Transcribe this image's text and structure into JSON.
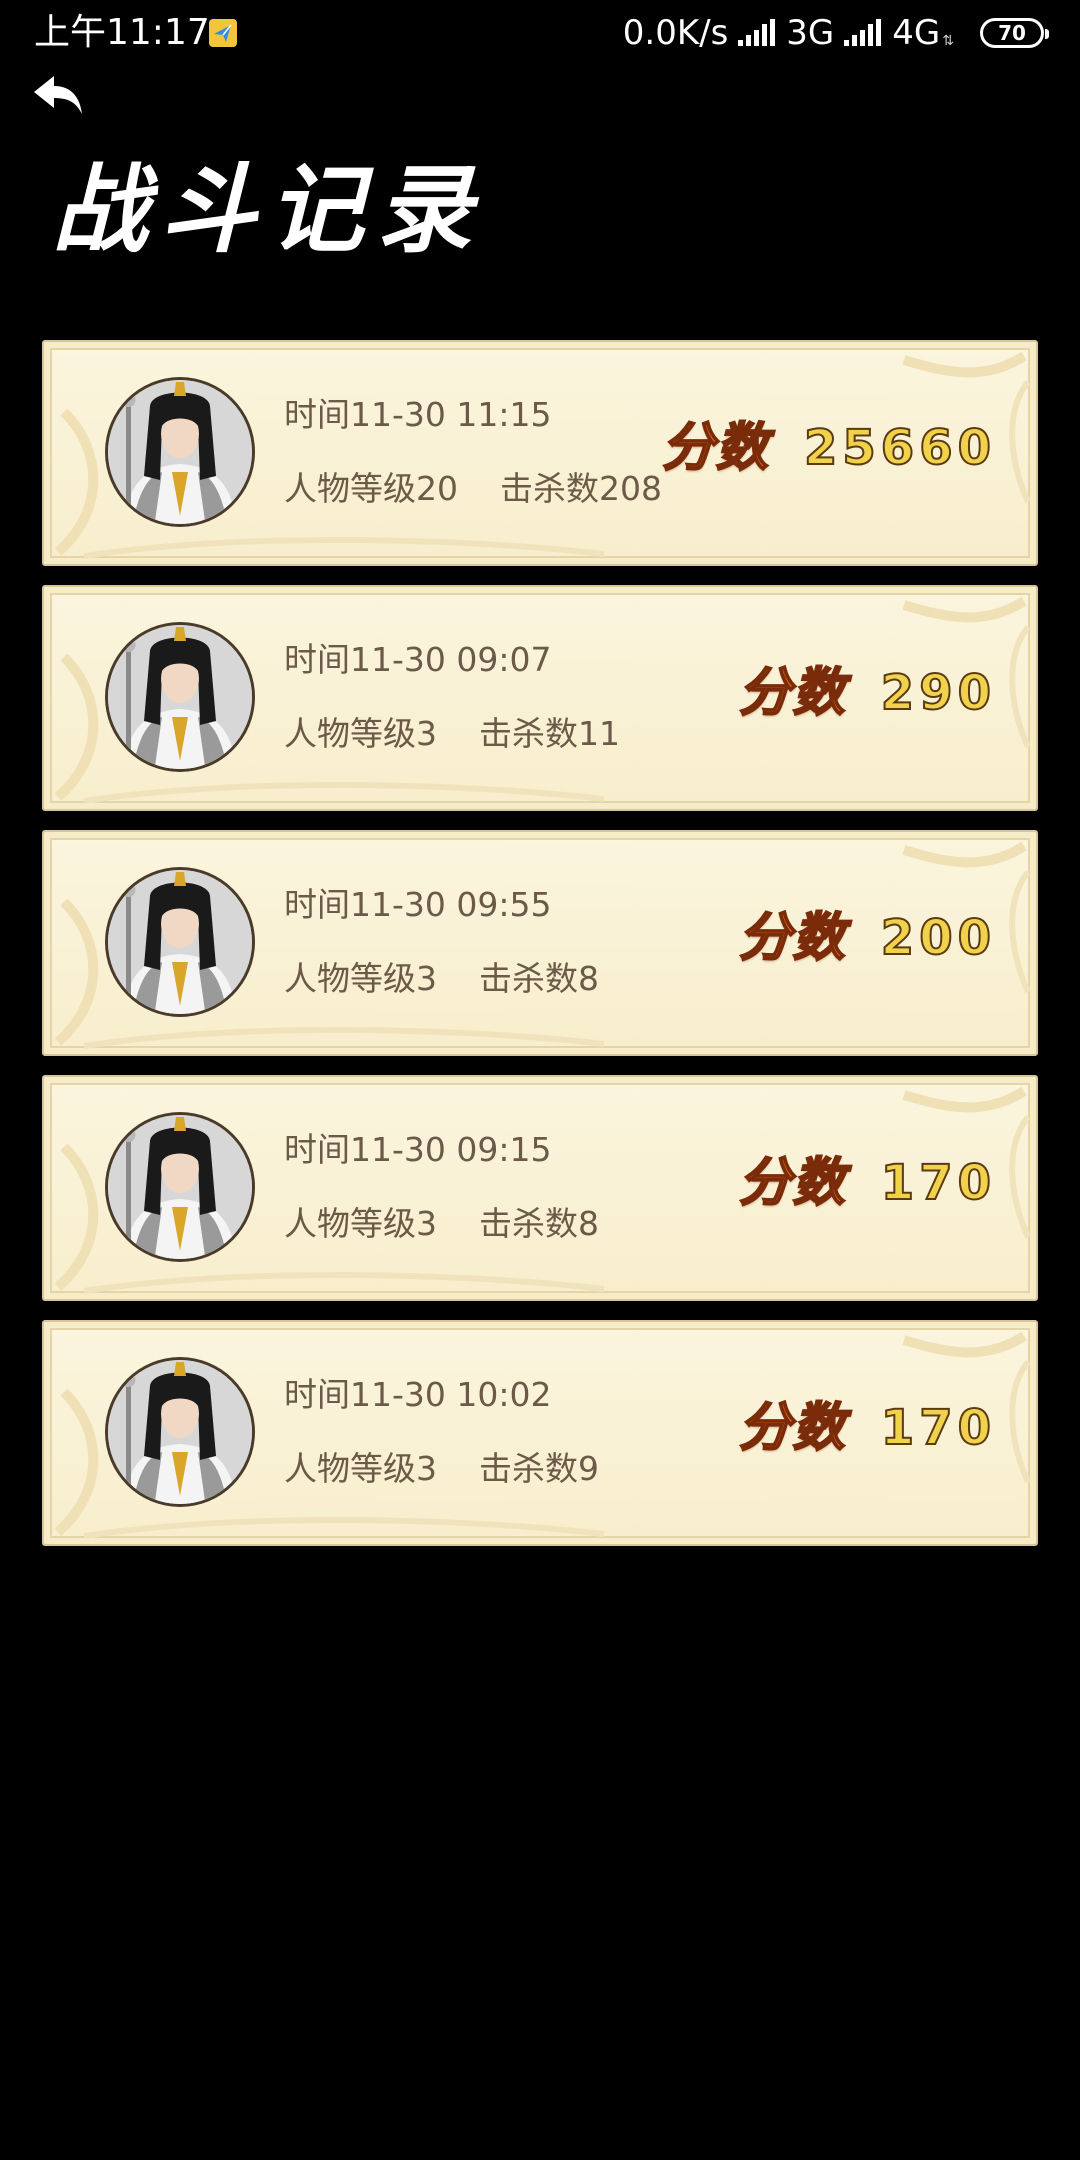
{
  "status_bar": {
    "time": "上午11:17",
    "network_speed": "0.0K/s",
    "network_1": "3G",
    "network_2": "4G",
    "battery": "70"
  },
  "header": {
    "title": "战斗记录"
  },
  "colors": {
    "card_background": "#fbf5de",
    "card_border": "#d8c69a",
    "text_muted": "#6c5a48",
    "score_label": "#ee6a12",
    "score_value": "#f1d24c"
  },
  "icons": {
    "back": "back-arrow-icon",
    "avatar": "character-portrait"
  },
  "records": [
    {
      "time": "时间11-30 11:15",
      "level": "人物等级20",
      "kills": "击杀数208",
      "score_label": "分数",
      "score": "25660"
    },
    {
      "time": "时间11-30 09:07",
      "level": "人物等级3",
      "kills": "击杀数11",
      "score_label": "分数",
      "score": "290"
    },
    {
      "time": "时间11-30 09:55",
      "level": "人物等级3",
      "kills": "击杀数8",
      "score_label": "分数",
      "score": "200"
    },
    {
      "time": "时间11-30 09:15",
      "level": "人物等级3",
      "kills": "击杀数8",
      "score_label": "分数",
      "score": "170"
    },
    {
      "time": "时间11-30 10:02",
      "level": "人物等级3",
      "kills": "击杀数9",
      "score_label": "分数",
      "score": "170"
    }
  ]
}
